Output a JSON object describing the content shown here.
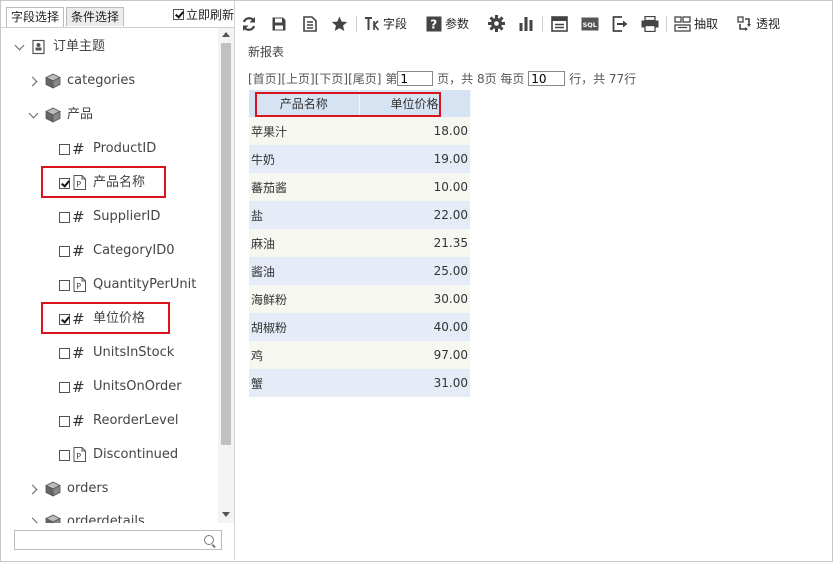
{
  "left_panel": {
    "tabs": [
      "字段选择",
      "条件选择"
    ],
    "auto_refresh_label": "立即刷新",
    "auto_refresh_checked": true,
    "tree": {
      "root_label": "订单主题",
      "categories_label": "categories",
      "product_label": "产品",
      "fields": [
        {
          "label": "ProductID",
          "type": "number",
          "checked": false
        },
        {
          "label": "产品名称",
          "type": "text",
          "checked": true
        },
        {
          "label": "SupplierID",
          "type": "number",
          "checked": false
        },
        {
          "label": "CategoryID0",
          "type": "number",
          "checked": false
        },
        {
          "label": "QuantityPerUnit",
          "type": "text",
          "checked": false
        },
        {
          "label": "单位价格",
          "type": "number",
          "checked": true
        },
        {
          "label": "UnitsInStock",
          "type": "number",
          "checked": false
        },
        {
          "label": "UnitsOnOrder",
          "type": "number",
          "checked": false
        },
        {
          "label": "ReorderLevel",
          "type": "number",
          "checked": false
        },
        {
          "label": "Discontinued",
          "type": "text",
          "checked": false
        }
      ],
      "orders_label": "orders",
      "orderdetails_label": "orderdetails"
    },
    "search_placeholder": ""
  },
  "toolbar": {
    "refresh": "refresh-icon",
    "save": "save-icon",
    "save_as": "save-as-icon",
    "favorite": "star-icon",
    "fields_label": "字段",
    "params_label": "参数",
    "settings": "gear-icon",
    "chart": "bar-chart-icon",
    "layout": "layout-icon",
    "sql": "SQL",
    "export": "export-icon",
    "print": "print-icon",
    "extract_label": "抽取",
    "pivot_label": "透视"
  },
  "report": {
    "title": "新报表",
    "pager": {
      "first": "[首页]",
      "prev": "[上页]",
      "next": "[下页]",
      "last": "[尾页]",
      "page_prefix": "第",
      "page_value": "1",
      "page_suffix": "页，共 8页 每页",
      "page_size": "10",
      "rows_suffix": "行，共 77行"
    },
    "columns": [
      "产品名称",
      "单位价格"
    ],
    "rows": [
      [
        "苹果汁",
        "18.00"
      ],
      [
        "牛奶",
        "19.00"
      ],
      [
        "蕃茄酱",
        "10.00"
      ],
      [
        "盐",
        "22.00"
      ],
      [
        "麻油",
        "21.35"
      ],
      [
        "酱油",
        "25.00"
      ],
      [
        "海鲜粉",
        "30.00"
      ],
      [
        "胡椒粉",
        "40.00"
      ],
      [
        "鸡",
        "97.00"
      ],
      [
        "蟹",
        "31.00"
      ]
    ]
  },
  "colors": {
    "highlight": "#d9141c",
    "header_bg": "#d6e3f3",
    "row_even": "#e6ebf8",
    "row_odd": "#f7f7f2"
  }
}
